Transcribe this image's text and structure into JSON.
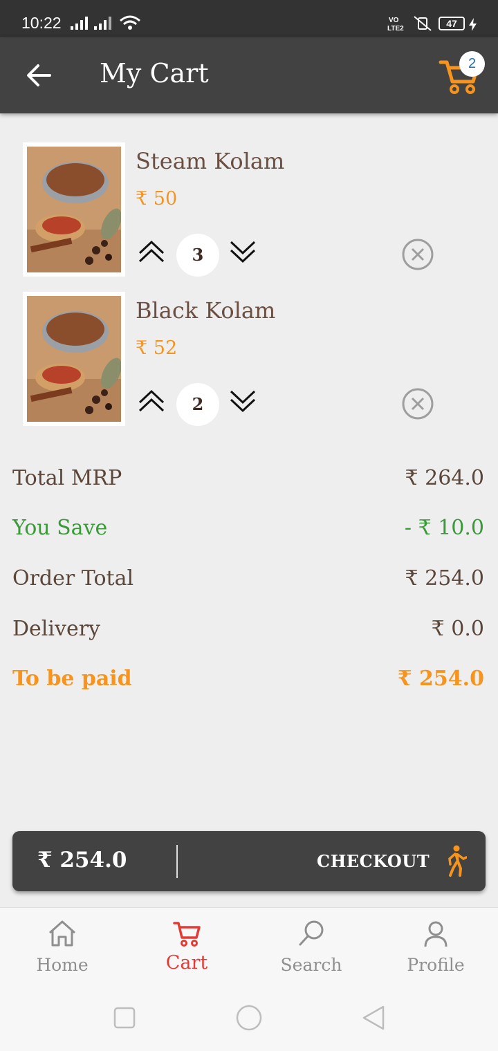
{
  "status_bar": {
    "time": "10:22",
    "battery": "47"
  },
  "app_bar": {
    "title": "My Cart",
    "cart_count": "2"
  },
  "cart_items": [
    {
      "name": "Steam Kolam",
      "price": "₹ 50",
      "quantity": "3"
    },
    {
      "name": "Black Kolam",
      "price": "₹ 52",
      "quantity": "2"
    }
  ],
  "summary": {
    "total_mrp_label": "Total MRP",
    "total_mrp_value": "₹ 264.0",
    "you_save_label": "You Save",
    "you_save_value": "- ₹ 10.0",
    "order_total_label": "Order Total",
    "order_total_value": "₹ 254.0",
    "delivery_label": "Delivery",
    "delivery_value": "₹ 0.0",
    "to_be_paid_label": "To be paid",
    "to_be_paid_value": "₹ 254.0"
  },
  "checkout_bar": {
    "total": "₹ 254.0",
    "button_label": "CHECKOUT"
  },
  "bottom_nav": [
    {
      "label": "Home",
      "icon": "home-icon"
    },
    {
      "label": "Cart",
      "icon": "cart-icon",
      "active": true
    },
    {
      "label": "Search",
      "icon": "search-icon"
    },
    {
      "label": "Profile",
      "icon": "profile-icon"
    }
  ],
  "colors": {
    "accent": "#f7941d",
    "appbar": "#424242",
    "save": "#3a9a3a",
    "active_tab": "#e53935"
  }
}
